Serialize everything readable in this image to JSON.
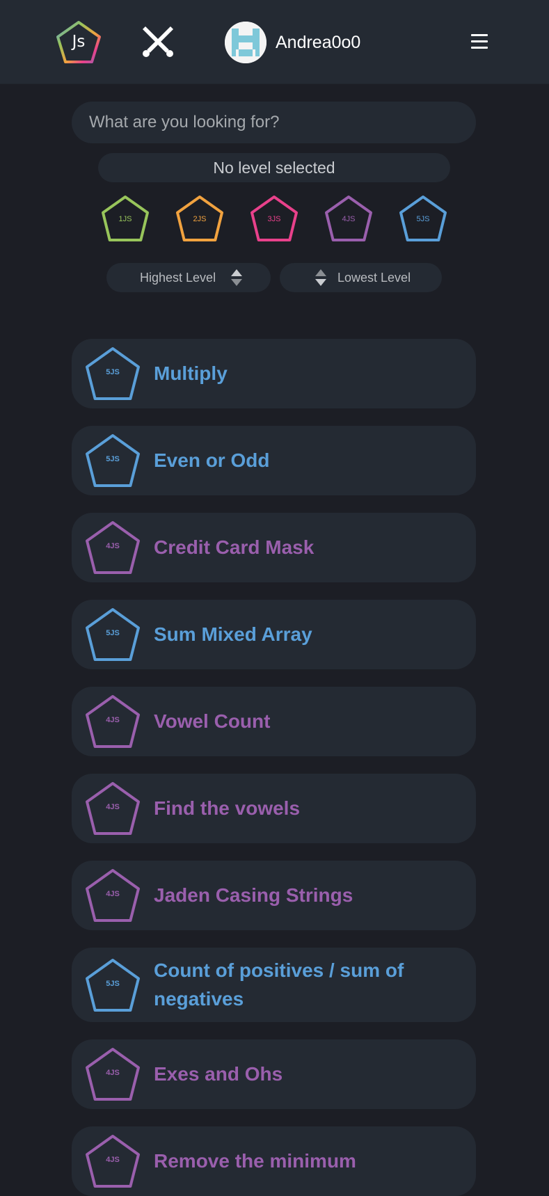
{
  "header": {
    "logo_text": "Js",
    "username": "Andrea0o0",
    "icons": [
      "js-logo-icon",
      "crossed-swords-icon",
      "avatar",
      "hamburger-menu-icon"
    ]
  },
  "search": {
    "placeholder": "What are you looking for?",
    "value": ""
  },
  "level_display": "No level selected",
  "level_filters": [
    {
      "label": "1JS",
      "color": "#98c55b"
    },
    {
      "label": "2JS",
      "color": "#f1a23f"
    },
    {
      "label": "3JS",
      "color": "#e8418b"
    },
    {
      "label": "4JS",
      "color": "#9a5fad"
    },
    {
      "label": "5JS",
      "color": "#5a9fd9"
    }
  ],
  "sort": {
    "highest": "Highest Level",
    "lowest": "Lowest Level"
  },
  "level_colors": {
    "4JS": "#9a5fad",
    "5JS": "#5a9fd9"
  },
  "katas": [
    {
      "level": "5JS",
      "title": "Multiply"
    },
    {
      "level": "5JS",
      "title": "Even or Odd"
    },
    {
      "level": "4JS",
      "title": "Credit Card Mask"
    },
    {
      "level": "5JS",
      "title": "Sum Mixed Array"
    },
    {
      "level": "4JS",
      "title": "Vowel Count"
    },
    {
      "level": "4JS",
      "title": "Find the vowels"
    },
    {
      "level": "4JS",
      "title": "Jaden Casing Strings"
    },
    {
      "level": "5JS",
      "title": "Count of positives / sum of negatives"
    },
    {
      "level": "4JS",
      "title": "Exes and Ohs"
    },
    {
      "level": "4JS",
      "title": "Remove the minimum"
    }
  ]
}
